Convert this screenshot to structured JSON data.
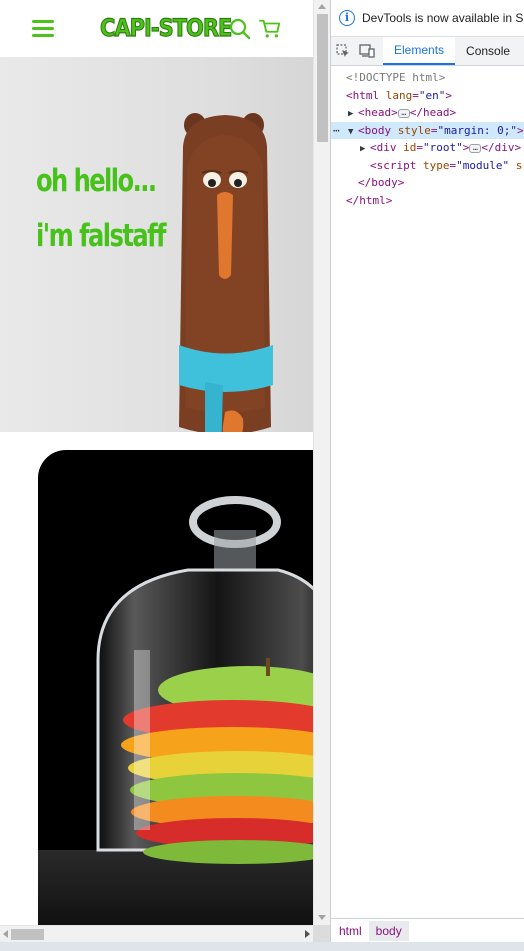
{
  "site": {
    "logo_text": "CAPI-STORE",
    "hero": {
      "line1": "oh hello...",
      "line2": "i'm falstaff"
    },
    "colors": {
      "brand_green": "#4cc21a",
      "hero_text": "#47c21a"
    },
    "icons": {
      "menu": "hamburger-icon",
      "search": "search-icon",
      "cart": "cart-icon"
    }
  },
  "devtools": {
    "info_text": "DevTools is now available in Sp",
    "tabs": [
      "Elements",
      "Console"
    ],
    "dom": {
      "doctype": "<!DOCTYPE html>",
      "html_open_tag": "<html",
      "html_attr": "lang",
      "html_attr_val": "\"en\"",
      "html_close_bracket": ">",
      "head_open": "<head>",
      "head_close": "</head>",
      "body_open_tag": "<body",
      "body_attr": "style",
      "body_attr_val": "\"margin: 0;\"",
      "body_close_bracket": ">",
      "div_open_tag": "<div",
      "div_attr": "id",
      "div_attr_val": "\"root\"",
      "div_close_bracket": ">",
      "div_close": "</div>",
      "script_open_tag": "<script",
      "script_attr": "type",
      "script_attr_val": "\"module\"",
      "script_trailing": "sr",
      "body_close": "</body>",
      "html_close": "</html>",
      "ellipsis": "…"
    },
    "breadcrumbs": [
      "html",
      "body"
    ]
  }
}
